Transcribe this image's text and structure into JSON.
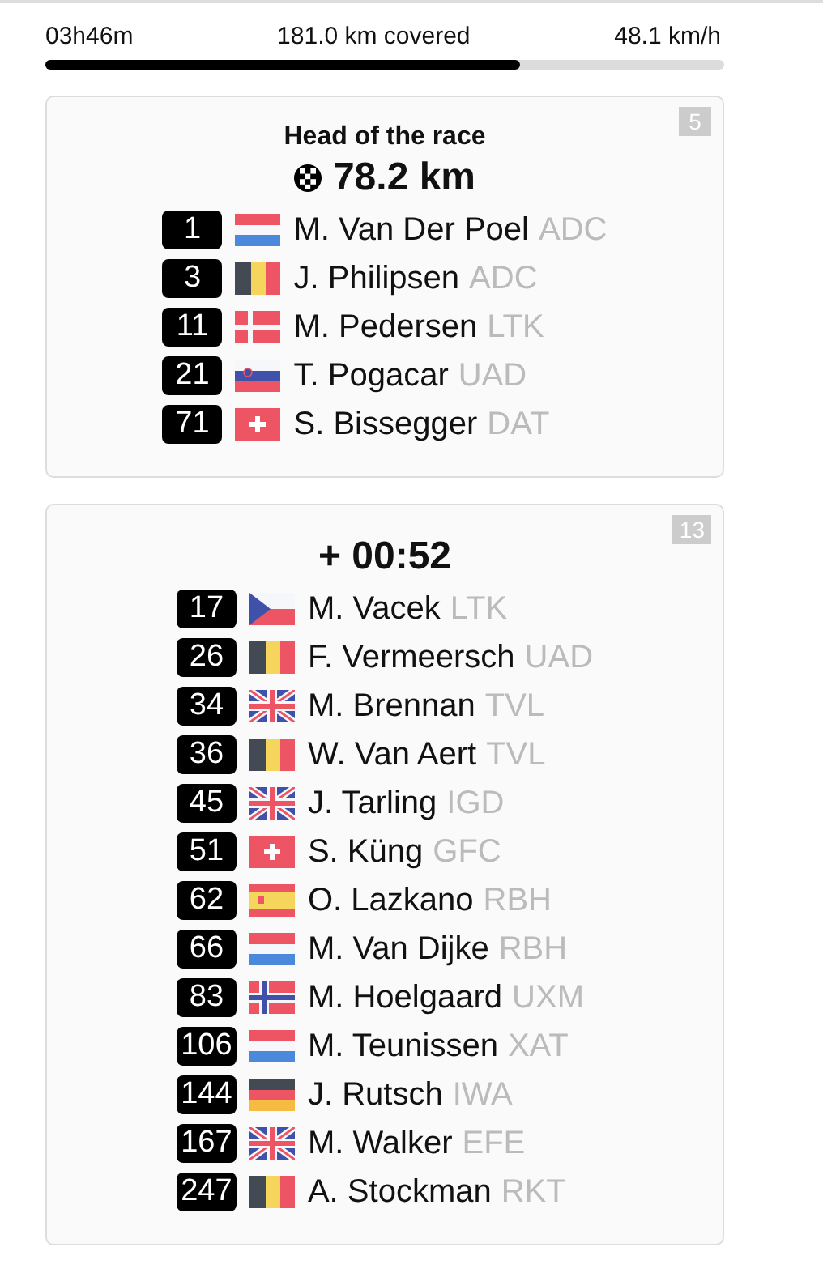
{
  "progress": {
    "elapsed": "03h46m",
    "covered": "181.0 km covered",
    "speed": "48.1 km/h",
    "level": 0.7
  },
  "groups": [
    {
      "title": "Head of the race",
      "headline": "78.2 km",
      "finish_icon": true,
      "count": "5",
      "riders": [
        {
          "number": "1",
          "kind": "nl",
          "name": "M. Van Der Poel",
          "team": "ADC"
        },
        {
          "number": "3",
          "kind": "be",
          "name": "J. Philipsen",
          "team": "ADC"
        },
        {
          "number": "11",
          "kind": "dk",
          "name": "M. Pedersen",
          "team": "LTK"
        },
        {
          "number": "21",
          "kind": "si",
          "name": "T. Pogacar",
          "team": "UAD"
        },
        {
          "number": "71",
          "kind": "ch",
          "name": "S. Bissegger",
          "team": "DAT"
        }
      ]
    },
    {
      "headline": "+ 00:52",
      "finish_icon": false,
      "count": "13",
      "riders": [
        {
          "number": "17",
          "kind": "cz",
          "name": "M. Vacek",
          "team": "LTK"
        },
        {
          "number": "26",
          "kind": "be",
          "name": "F. Vermeersch",
          "team": "UAD"
        },
        {
          "number": "34",
          "kind": "gb",
          "name": "M. Brennan",
          "team": "TVL"
        },
        {
          "number": "36",
          "kind": "be",
          "name": "W. Van Aert",
          "team": "TVL"
        },
        {
          "number": "45",
          "kind": "gb",
          "name": "J. Tarling",
          "team": "IGD"
        },
        {
          "number": "51",
          "kind": "ch",
          "name": "S. Küng",
          "team": "GFC"
        },
        {
          "number": "62",
          "kind": "es",
          "name": "O. Lazkano",
          "team": "RBH"
        },
        {
          "number": "66",
          "kind": "nl",
          "name": "M. Van Dijke",
          "team": "RBH"
        },
        {
          "number": "83",
          "kind": "no",
          "name": "M. Hoelgaard",
          "team": "UXM"
        },
        {
          "number": "106",
          "kind": "nl",
          "name": "M. Teunissen",
          "team": "XAT"
        },
        {
          "number": "144",
          "kind": "de",
          "name": "J. Rutsch",
          "team": "IWA"
        },
        {
          "number": "167",
          "kind": "gb",
          "name": "M. Walker",
          "team": "EFE"
        },
        {
          "number": "247",
          "kind": "be",
          "name": "A. Stockman",
          "team": "RKT"
        }
      ]
    }
  ]
}
